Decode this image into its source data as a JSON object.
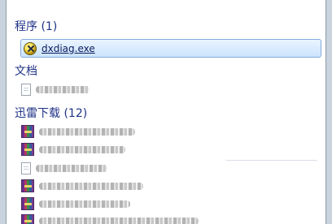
{
  "groups": [
    {
      "title": "程序 (1)",
      "items": [
        {
          "label": "dxdiag.exe",
          "icon": "dxdiag-icon",
          "selected": true
        }
      ]
    },
    {
      "title": "文档",
      "items": [
        {
          "label": "",
          "icon": "document-icon",
          "redacted": true
        }
      ]
    },
    {
      "title": "迅雷下载 (12)",
      "items": [
        {
          "label": "",
          "icon": "archive-icon",
          "redacted": true
        },
        {
          "label": "",
          "icon": "archive-icon",
          "redacted": true
        },
        {
          "label": "",
          "icon": "document-icon",
          "redacted": true
        },
        {
          "label": "",
          "icon": "archive-icon",
          "redacted": true
        },
        {
          "label": "",
          "icon": "archive-icon",
          "redacted": true
        },
        {
          "label": "",
          "icon": "archive-icon",
          "redacted": true
        }
      ]
    }
  ],
  "colors": {
    "header": "#1e3287",
    "selection_border": "#84acdd",
    "selection_fill": "#cbe4fc"
  }
}
